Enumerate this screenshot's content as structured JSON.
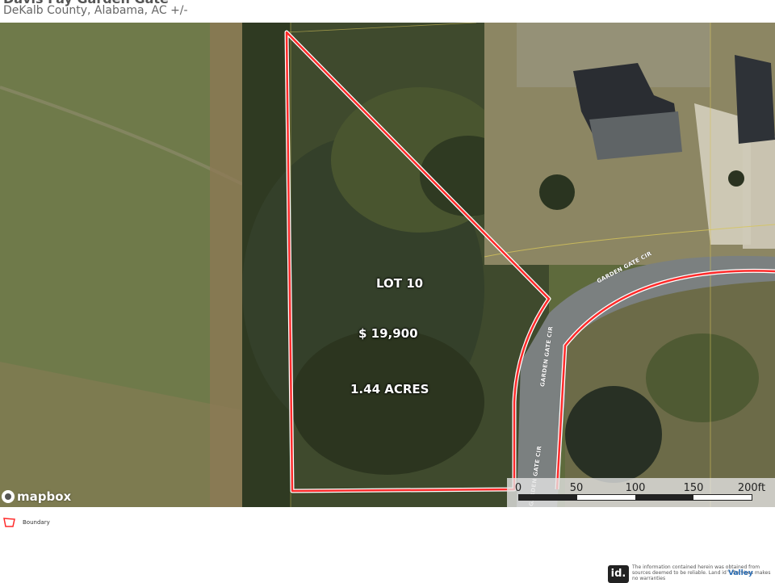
{
  "header": {
    "title": "Davis Fay Garden Gate",
    "subtitle": "DeKalb County, Alabama,  AC +/-"
  },
  "map": {
    "lot_label": "LOT 10",
    "price_label": "$ 19,900",
    "acreage_label": "1.44 ACRES",
    "road_labels": [
      "GARDEN GATE CIR",
      "GARDEN GATE CIR",
      "GARDEN GATE CIR"
    ],
    "attribution": "mapbox",
    "boundary_color": "#ff2a2a"
  },
  "scale": {
    "ticks": [
      "0",
      "50",
      "100",
      "150",
      "200ft"
    ]
  },
  "legend": {
    "label": "Boundary",
    "icon": "boundary-polygon-icon"
  },
  "footer": {
    "logo_text": "id.",
    "disclaimer": "The information contained herein was obtained from sources deemed to be reliable. Land id™ Services makes no warranties",
    "brand": "Valley"
  }
}
